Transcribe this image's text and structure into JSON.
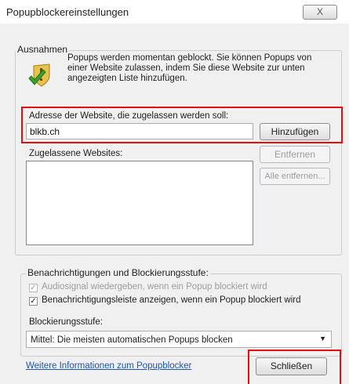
{
  "window": {
    "title": "Popupblockereinstellungen",
    "close_label": "X"
  },
  "exceptions": {
    "legend": "Ausnahmen",
    "info_text": "Popups werden momentan geblockt. Sie können Popups von einer Website zulassen, indem Sie diese Website zur unten angezeigten Liste hinzufügen.",
    "address_label": "Adresse der Website, die zugelassen werden soll:",
    "address_value": "blkb.ch",
    "add_button": "Hinzufügen",
    "allowed_label": "Zugelassene Websites:",
    "remove_button": "Entfernen",
    "remove_all_button": "Alle entfernen..."
  },
  "notifications": {
    "legend": "Benachrichtigungen und Blockierungsstufe:",
    "sound_option": "Audiosignal wiedergeben, wenn ein Popup blockiert wird",
    "sound_checked": true,
    "bar_option": "Benachrichtigungsleiste anzeigen, wenn ein Popup blockiert wird",
    "bar_checked": true,
    "level_label": "Blockierungsstufe:",
    "level_value": "Mittel: Die meisten automatischen Popups blocken"
  },
  "footer": {
    "more_info_link": "Weitere Informationen zum Popupblocker",
    "close_button": "Schließen"
  },
  "colors": {
    "highlight": "#e01010",
    "link": "#1a56b5"
  }
}
